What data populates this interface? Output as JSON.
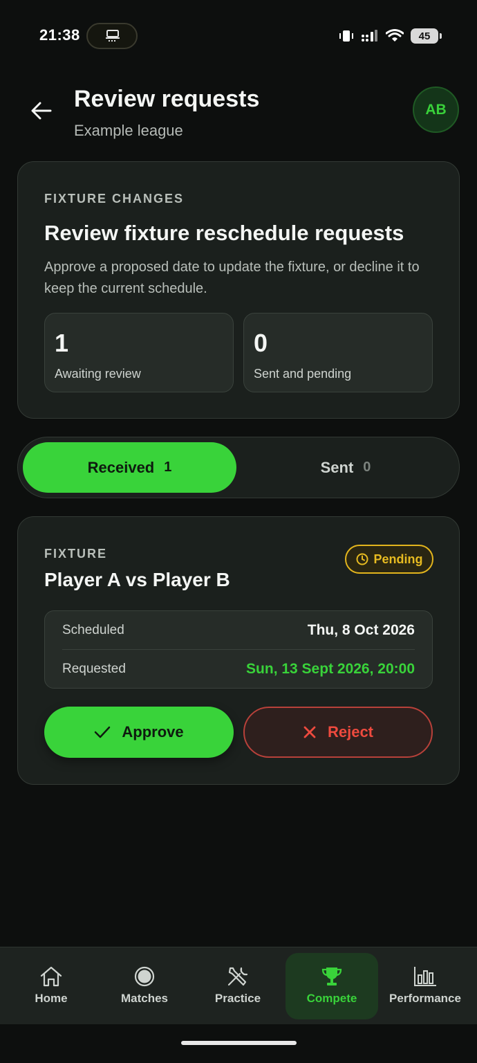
{
  "status_bar": {
    "time": "21:38",
    "battery": "45"
  },
  "header": {
    "title": "Review requests",
    "subtitle": "Example league",
    "avatar_initials": "AB"
  },
  "summary": {
    "eyebrow": "FIXTURE CHANGES",
    "title": "Review fixture reschedule requests",
    "description": "Approve a proposed date to update the fixture, or decline it to keep the current schedule.",
    "stats": [
      {
        "value": "1",
        "label": "Awaiting review"
      },
      {
        "value": "0",
        "label": "Sent and pending"
      }
    ]
  },
  "tabs": [
    {
      "label": "Received",
      "count": "1",
      "active": true
    },
    {
      "label": "Sent",
      "count": "0",
      "active": false
    }
  ],
  "request": {
    "eyebrow": "FIXTURE",
    "title": "Player A vs Player B",
    "status": "Pending",
    "scheduled_label": "Scheduled",
    "scheduled_value": "Thu, 8 Oct 2026",
    "requested_label": "Requested",
    "requested_value": "Sun, 13 Sept 2026, 20:00",
    "approve_label": "Approve",
    "reject_label": "Reject"
  },
  "nav": {
    "items": [
      {
        "label": "Home",
        "icon": "home-icon"
      },
      {
        "label": "Matches",
        "icon": "ball-icon"
      },
      {
        "label": "Practice",
        "icon": "tools-icon"
      },
      {
        "label": "Compete",
        "icon": "trophy-icon",
        "active": true
      },
      {
        "label": "Performance",
        "icon": "bar-chart-icon"
      }
    ]
  },
  "colors": {
    "accent": "#39d33a",
    "pending": "#e7bb21",
    "danger": "#ee4a3e",
    "background": "#0d0f0e",
    "card": "#1b201d"
  }
}
